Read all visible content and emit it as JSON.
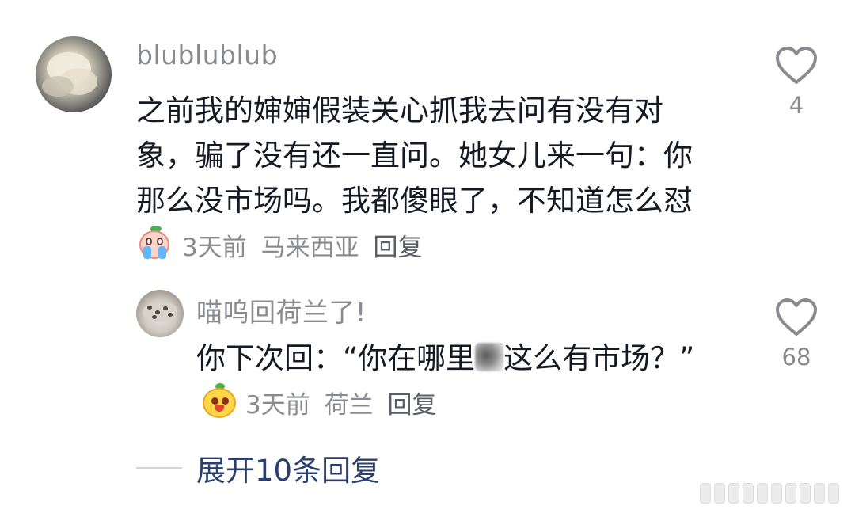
{
  "comment": {
    "username": "blublublub",
    "text": "之前我的婶婶假装关心抓我去问有没有对象，骗了没有还一直问。她女儿来一句：你那么没市场吗。我都傻眼了，不知道怎么怼",
    "emoji": "crying-face-emoji",
    "time": "3天前",
    "location": "马来西亚",
    "reply_label": "回复",
    "likes": "4"
  },
  "reply": {
    "username": "喵呜回荷兰了!",
    "text_before": "你下次回：“你在哪里",
    "text_after": "这么有市场？”",
    "emoji": "smiling-face-emoji",
    "time": "3天前",
    "location": "荷兰",
    "reply_label": "回复",
    "likes": "68"
  },
  "expand": {
    "label": "展开10条回复"
  },
  "colors": {
    "text": "#161823",
    "muted": "#8a8b91",
    "link": "#2a3f6d",
    "heart_outline": "#8a8b91"
  },
  "icons": {
    "like": "heart-icon"
  }
}
